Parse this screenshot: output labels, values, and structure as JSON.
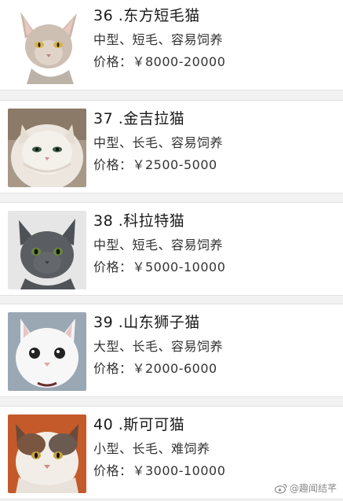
{
  "cats": [
    {
      "title": "36 .东方短毛猫",
      "tags": "中型、短毛、容易饲养",
      "price": "价格：￥8000-20000",
      "icon": "oriental-shorthair-photo"
    },
    {
      "title": "37 .金吉拉猫",
      "tags": "中型、长毛、容易饲养",
      "price": "价格：￥2500-5000",
      "icon": "chinchilla-photo"
    },
    {
      "title": "38 .科拉特猫",
      "tags": "中型、短毛、容易饲养",
      "price": "价格：￥5000-10000",
      "icon": "korat-photo"
    },
    {
      "title": "39 .山东狮子猫",
      "tags": "大型、长毛、容易饲养",
      "price": "价格：￥2000-6000",
      "icon": "shandong-lion-cat-photo"
    },
    {
      "title": "40 .斯可可猫",
      "tags": "小型、长毛、难饲养",
      "price": "价格：￥3000-10000",
      "icon": "calico-cat-photo"
    }
  ],
  "watermark": "@趣闻结芊",
  "colors": {
    "background": "#f2f2f2",
    "card": "#ffffff",
    "text": "#1a1a1a"
  }
}
